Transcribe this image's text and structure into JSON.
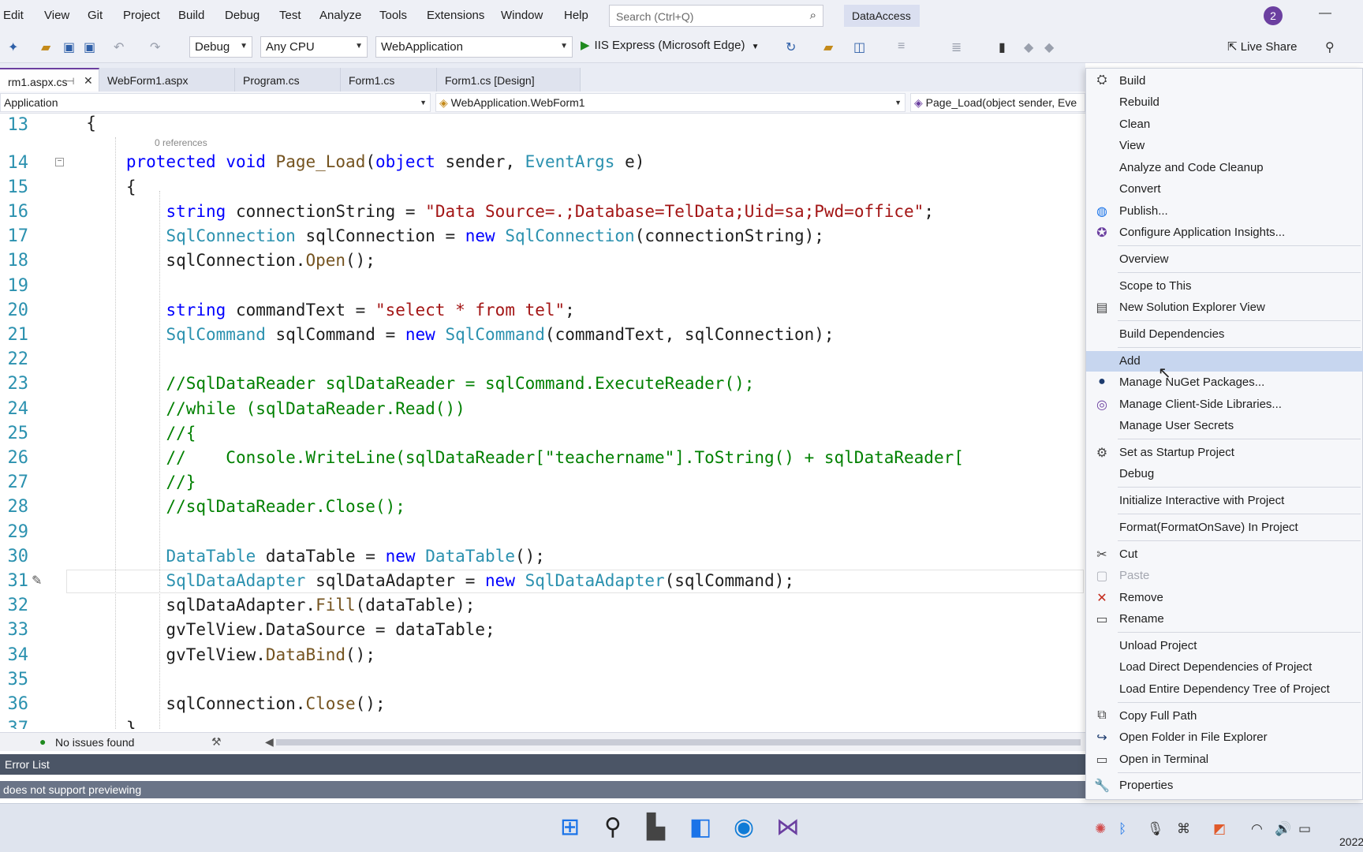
{
  "menubar": {
    "items": [
      "Edit",
      "View",
      "Git",
      "Project",
      "Build",
      "Debug",
      "Test",
      "Analyze",
      "Tools",
      "Extensions",
      "Window",
      "Help"
    ],
    "search_placeholder": "Search (Ctrl+Q)",
    "solution_name": "DataAccess",
    "profile_badge": "2"
  },
  "toolbar": {
    "configuration": "Debug",
    "platform": "Any CPU",
    "startup_project": "WebApplication",
    "run_label": "IIS Express (Microsoft Edge)",
    "live_share_label": "Live Share"
  },
  "tabs": [
    {
      "label": "rm1.aspx.cs"
    },
    {
      "label": "WebForm1.aspx"
    },
    {
      "label": "Program.cs"
    },
    {
      "label": "Form1.cs"
    },
    {
      "label": "Form1.cs [Design]"
    }
  ],
  "navbar": {
    "project": "Application",
    "type": "WebApplication.WebForm1",
    "member": "Page_Load(object sender, Eve"
  },
  "editor": {
    "references": "0 references",
    "line_numbers": [
      "13",
      "14",
      "15",
      "16",
      "17",
      "18",
      "19",
      "20",
      "21",
      "22",
      "23",
      "24",
      "25",
      "26",
      "27",
      "28",
      "29",
      "30",
      "31",
      "32",
      "33",
      "34",
      "35",
      "36",
      "37"
    ]
  },
  "editor_status": {
    "issues": "No issues found"
  },
  "error_list": {
    "title": "Error List"
  },
  "status_bar": {
    "text": "does not support previewing"
  },
  "clock": {
    "date": "2022-"
  },
  "context_menu": {
    "items": [
      {
        "label": "Build",
        "icon": "build-icon"
      },
      {
        "label": "Rebuild"
      },
      {
        "label": "Clean"
      },
      {
        "label": "View"
      },
      {
        "label": "Analyze and Code Cleanup"
      },
      {
        "label": "Convert"
      },
      {
        "label": "Publish...",
        "icon": "globe-icon"
      },
      {
        "label": "Configure Application Insights...",
        "icon": "lightbulb-icon"
      },
      {
        "label": "Overview"
      },
      {
        "label": "Scope to This"
      },
      {
        "label": "New Solution Explorer View",
        "icon": "window-icon"
      },
      {
        "label": "Build Dependencies"
      },
      {
        "label": "Add"
      },
      {
        "label": "Manage NuGet Packages...",
        "icon": "nuget-icon"
      },
      {
        "label": "Manage Client-Side Libraries...",
        "icon": "libraries-icon"
      },
      {
        "label": "Manage User Secrets"
      },
      {
        "label": "Set as Startup Project",
        "icon": "gear-icon"
      },
      {
        "label": "Debug"
      },
      {
        "label": "Initialize Interactive with Project"
      },
      {
        "label": "Format(FormatOnSave) In Project"
      },
      {
        "label": "Cut",
        "icon": "scissors-icon"
      },
      {
        "label": "Paste",
        "icon": "clipboard-icon"
      },
      {
        "label": "Remove",
        "icon": "close-icon"
      },
      {
        "label": "Rename",
        "icon": "rename-icon"
      },
      {
        "label": "Unload Project"
      },
      {
        "label": "Load Direct Dependencies of Project"
      },
      {
        "label": "Load Entire Dependency Tree of Project"
      },
      {
        "label": "Copy Full Path",
        "icon": "copy-icon"
      },
      {
        "label": "Open Folder in File Explorer",
        "icon": "open-folder-icon"
      },
      {
        "label": "Open in Terminal",
        "icon": "terminal-icon"
      },
      {
        "label": "Properties",
        "icon": "wrench-icon"
      }
    ]
  },
  "colors": {
    "accent": "#6b3fa0",
    "keyword": "#0000ff",
    "type": "#2b91af",
    "string": "#a31515",
    "comment": "#008000",
    "menu_highlight": "#c7d6ef"
  }
}
